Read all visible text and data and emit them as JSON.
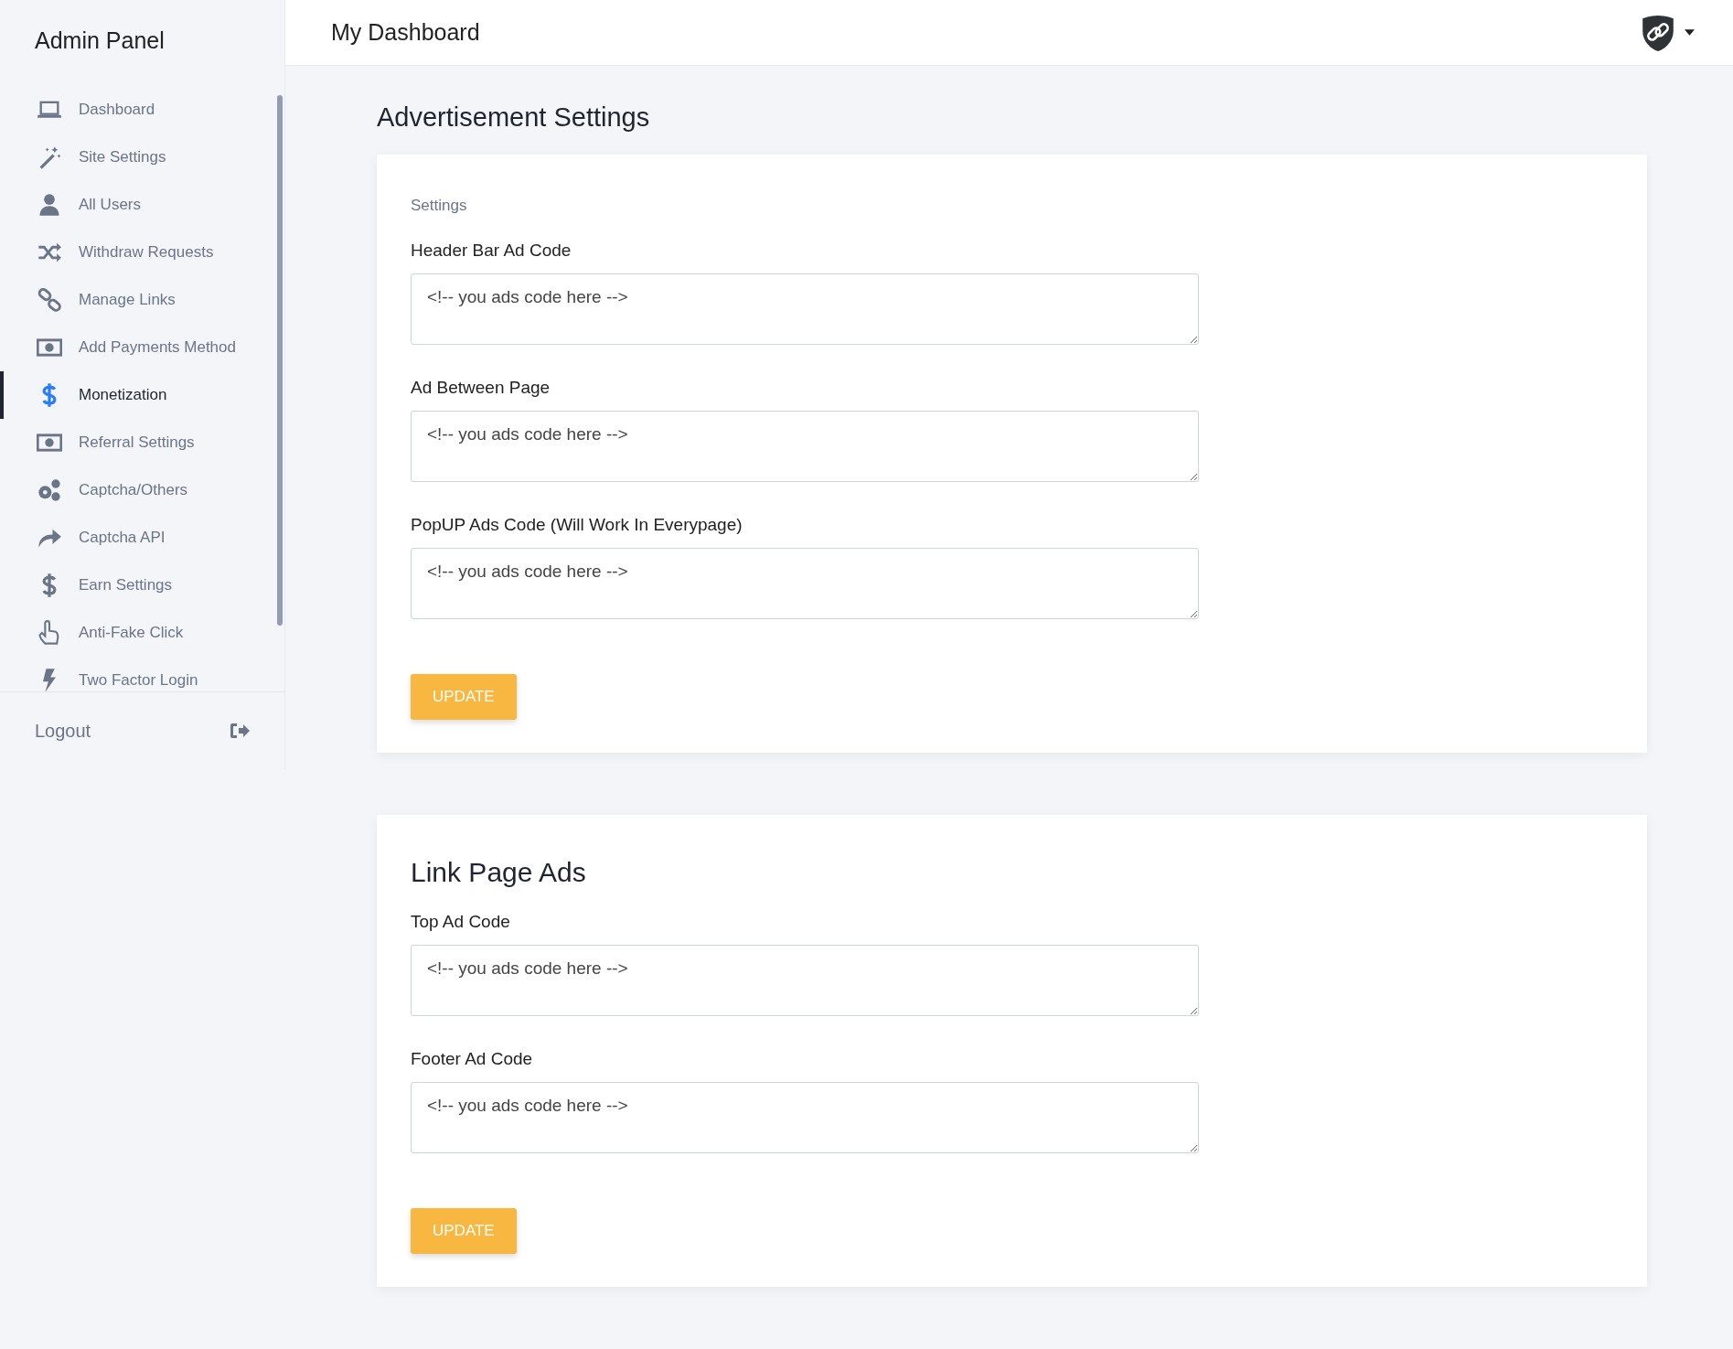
{
  "sidebar": {
    "title": "Admin Panel",
    "items": [
      {
        "label": "Dashboard",
        "selected": false
      },
      {
        "label": "Site Settings",
        "selected": false
      },
      {
        "label": "All Users",
        "selected": false
      },
      {
        "label": "Withdraw Requests",
        "selected": false
      },
      {
        "label": "Manage Links",
        "selected": false
      },
      {
        "label": "Add Payments Method",
        "selected": false
      },
      {
        "label": "Monetization",
        "selected": true
      },
      {
        "label": "Referral Settings",
        "selected": false
      },
      {
        "label": "Captcha/Others",
        "selected": false
      },
      {
        "label": "Captcha API",
        "selected": false
      },
      {
        "label": "Earn Settings",
        "selected": false
      },
      {
        "label": "Anti-Fake Click",
        "selected": false
      },
      {
        "label": "Two Factor Login",
        "selected": false
      }
    ],
    "logout": "Logout"
  },
  "header": {
    "title": "My Dashboard"
  },
  "page_title": "Advertisement Settings",
  "cards": [
    {
      "subtitle": "Settings",
      "fields": [
        {
          "label": "Header Bar Ad Code",
          "value": "<!-- you ads code here -->"
        },
        {
          "label": "Ad Between Page",
          "value": "<!-- you ads code here -->"
        },
        {
          "label": "PopUP Ads Code (Will Work In Everypage)",
          "value": "<!-- you ads code here -->"
        }
      ],
      "button": "UPDATE"
    },
    {
      "heading": "Link Page Ads",
      "fields": [
        {
          "label": "Top Ad Code",
          "value": "<!-- you ads code here -->"
        },
        {
          "label": "Footer Ad Code",
          "value": "<!-- you ads code here -->"
        }
      ],
      "button": "UPDATE"
    }
  ]
}
